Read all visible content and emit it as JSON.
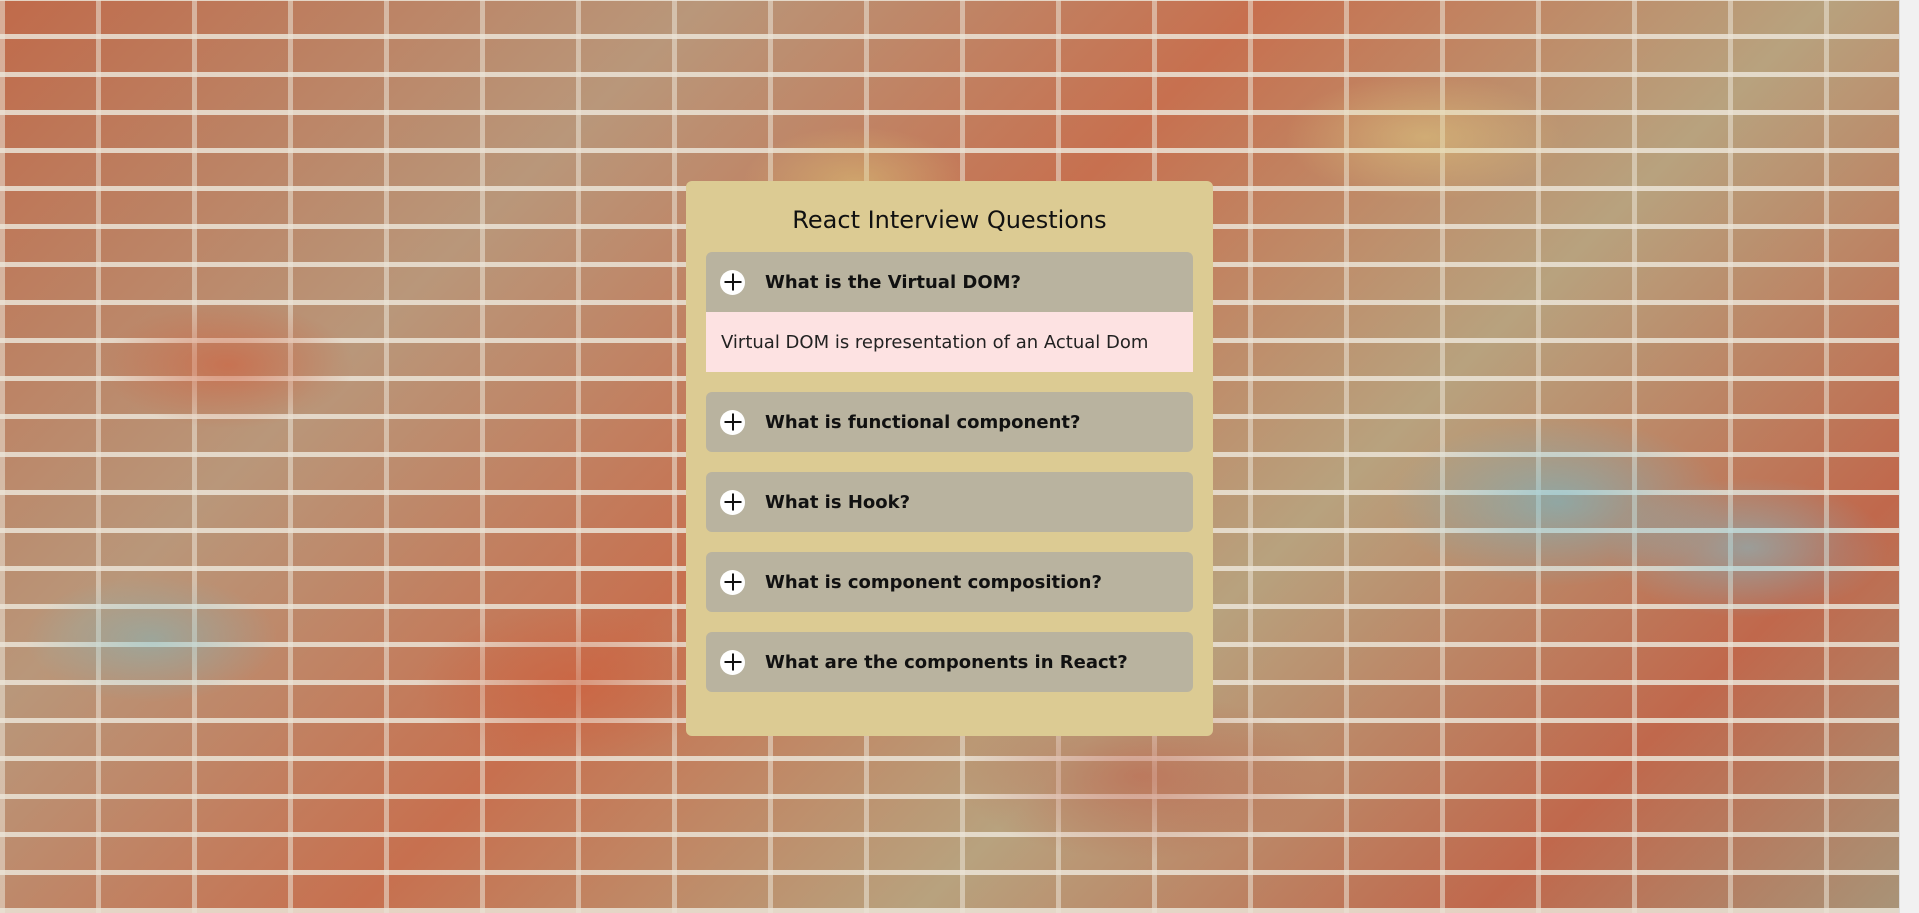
{
  "app": {
    "title": "React Interview Questions"
  },
  "faq": {
    "items": [
      {
        "question": "What is the Virtual DOM?",
        "answer": "Virtual DOM is representation of an Actual Dom",
        "expanded": true
      },
      {
        "question": "What is functional component?",
        "expanded": false
      },
      {
        "question": "What is Hook?",
        "expanded": false
      },
      {
        "question": "What is component composition?",
        "expanded": false
      },
      {
        "question": "What are the components in React?",
        "expanded": false
      }
    ]
  },
  "icons": {
    "toggle": "plus-icon"
  },
  "colors": {
    "card": "#dccb93",
    "question_bg": "#b9b39f",
    "answer_bg": "#fde2e2"
  }
}
